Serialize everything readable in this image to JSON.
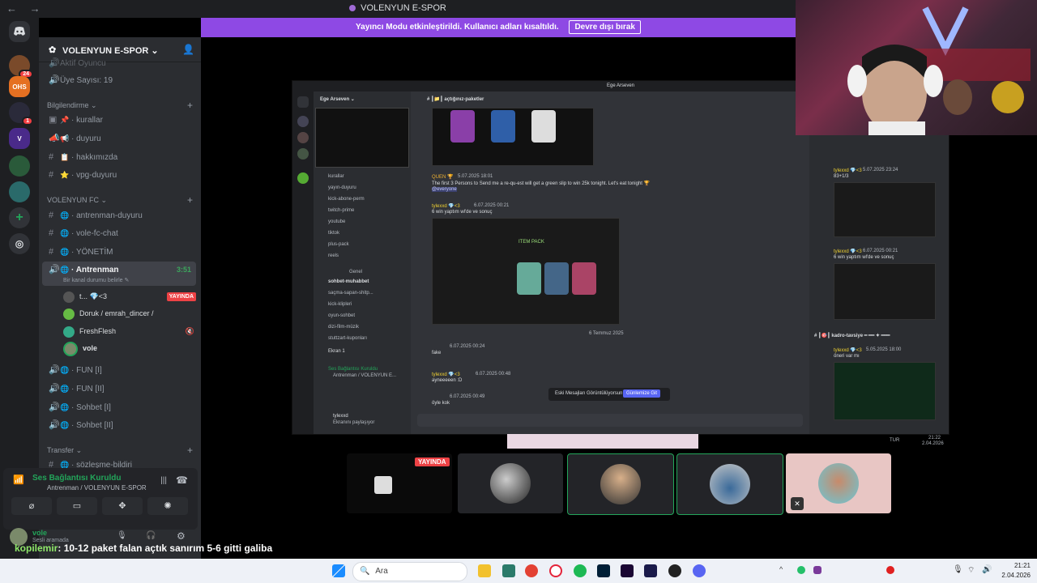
{
  "window": {
    "title": "VOLENYUN E-SPOR",
    "nav": "← →"
  },
  "banner": {
    "text": "Yayıncı Modu etkinleştirildi. Kullanıcı adları kısaltıldı.",
    "button": "Devre dışı bırak"
  },
  "rail": {
    "badges": [
      "24",
      "1"
    ],
    "labels": [
      "OHS"
    ]
  },
  "server": {
    "name": "VOLENYUN E-SPOR"
  },
  "sidebar": {
    "top_items": [
      {
        "label": "Aktif Oyuncu",
        "icon": "speaker-icon"
      },
      {
        "label": "Üye Sayısı: 19",
        "icon": "speaker-icon"
      }
    ],
    "categories": [
      {
        "label": "Bilgilendirme ⌄",
        "channels": [
          {
            "label": "kurallar",
            "emoji": "📌"
          },
          {
            "label": "duyuru",
            "emoji": "📢"
          },
          {
            "label": "hakkımızda",
            "emoji": "📋"
          },
          {
            "label": "vpg-duyuru",
            "emoji": "⭐"
          }
        ]
      },
      {
        "label": "VOLENYUN FC ⌄",
        "channels": [
          {
            "label": "antrenman-duyuru"
          },
          {
            "label": "vole-fc-chat"
          },
          {
            "label": "YÖNETİM"
          },
          {
            "label": "Antrenman",
            "time": "3:51",
            "status": "Bir kanal durumu belirle ✎"
          }
        ]
      },
      {
        "label": "Transfer ⌄",
        "channels": [
          {
            "label": "sözleşme-bildiri"
          }
        ]
      }
    ],
    "voice_users": [
      {
        "name": "t... 💎<3",
        "live": "YAYINDA"
      },
      {
        "name": "Doruk / emrah_dincer /"
      },
      {
        "name": "FreshFlesh"
      },
      {
        "name": "vole"
      }
    ],
    "voice_channels": [
      "FUN [I]",
      "FUN [II]",
      "Sohbet [I]",
      "Sohbet [II]"
    ]
  },
  "voice_panel": {
    "title": "Ses Bağlantısı Kuruldu",
    "subtitle": "Antrenman / VOLENYUN E-SPOR"
  },
  "user_panel": {
    "name": "vole",
    "status": "Sesli aramada"
  },
  "shared_screen": {
    "title": "Ege Arseven",
    "server_name": "Ege Arseven ⌄",
    "channel_header": "# ┃📁┃ açtığınız-paketler",
    "side_channels": [
      "kurallar",
      "yayın-duyuru",
      "kick-abone-perm",
      "twitch-prime",
      "youtube",
      "tiktok",
      "plus-pack",
      "reels",
      "Genel",
      "sohbet-muhabbet",
      "saçma-sapan-shitp...",
      "kick-klipleri",
      "oyun-sohbet",
      "dizi-film-müzik",
      "stuttzart-kuponları"
    ],
    "messages": [
      {
        "user": "QUEN 🏆",
        "time": "5.07.2025 18:01",
        "text": "The first 3 Persons to Send me a re-qu-est will get a green slip to win 25k  tonight. Let's eat tonight 🏆",
        "mention": "@everyone"
      },
      {
        "user": "tylexxd 💎<3",
        "time": "6.07.2025 00:21",
        "text": "6 win yaptım wl'de ve sonuç"
      },
      {
        "user": "",
        "time": "6.07.2025 00:24",
        "text": "fake"
      },
      {
        "user": "tylexxd 💎<3",
        "time": "6.07.2025 00:48",
        "text": "ayneeeeen :D"
      },
      {
        "user": "",
        "time": "6.07.2025 00:49",
        "text": "öyle kok"
      }
    ],
    "date_divider": "6 Temmuz 2025",
    "old_messages_note": "Eski Mesajları Görüntülüyorsun",
    "jump_button": "Günlemize Git",
    "right_panel": [
      {
        "user": "tylexxd 💎<3",
        "time": "5.07.2025 23:24",
        "text": "83+1/3"
      },
      {
        "user": "tylexxd 💎<3",
        "time": "6.07.2025 00:21",
        "text": "6 win yaptım wl'de ve sonuç"
      },
      {
        "channel": "# ┃🎯┃ kadro-tavsiye ━ ━━ ✦ ━━━"
      },
      {
        "user": "tylexxd 💎<3",
        "time": "5.05.2025 18:00",
        "text": "öneri var mı"
      }
    ],
    "inner_voice": {
      "title": "Ses Bağlantısı Kuruldu",
      "subtitle": "Antrenman / VOLENYUN E...",
      "screen": "Ekran 1",
      "user": "tylexxd",
      "user_status": "Ekranını paylaşıyor"
    },
    "pack_label": "ITEM PACK",
    "tray_clock": [
      "21:22",
      "2.04.2026"
    ],
    "tray_lang": "TUR"
  },
  "tiles": [
    {
      "live": "YAYINDA"
    }
  ],
  "caption": {
    "user": "kopilemir",
    "text": ": 10-12 paket falan açtık sanırım 5-6 gitti galiba"
  },
  "taskbar": {
    "search": "Ara",
    "time": "21:21",
    "date": "2.04.2026"
  },
  "colors": {
    "accent": "#8e49e4",
    "live": "#ed4245",
    "connected": "#23a55a"
  }
}
